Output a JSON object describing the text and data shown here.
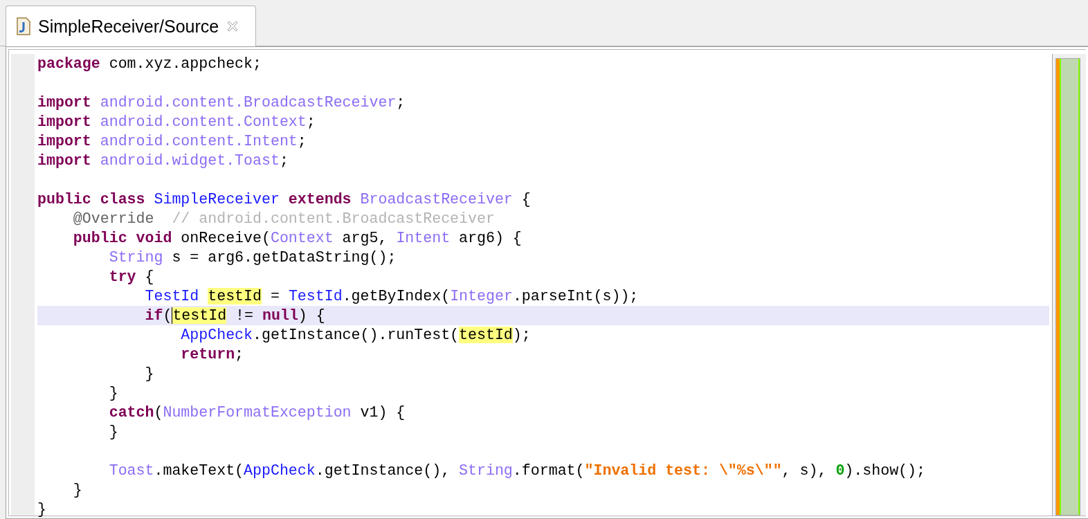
{
  "tabs": [
    {
      "label": "SimpleReceiver/Source",
      "selected": true
    }
  ],
  "code_lines": [
    {
      "kind": "code",
      "current": false,
      "tokens": [
        {
          "text": "package ",
          "kind": "kw"
        },
        {
          "text": "com.xyz.appcheck;",
          "kind": "plain"
        }
      ]
    },
    {
      "kind": "blank"
    },
    {
      "kind": "code",
      "current": false,
      "tokens": [
        {
          "text": "import ",
          "kind": "kw"
        },
        {
          "text": "android.content.BroadcastReceiver",
          "kind": "ext"
        },
        {
          "text": ";",
          "kind": "plain"
        }
      ]
    },
    {
      "kind": "code",
      "current": false,
      "tokens": [
        {
          "text": "import ",
          "kind": "kw"
        },
        {
          "text": "android.content.Context",
          "kind": "ext"
        },
        {
          "text": ";",
          "kind": "plain"
        }
      ]
    },
    {
      "kind": "code",
      "current": false,
      "tokens": [
        {
          "text": "import ",
          "kind": "kw"
        },
        {
          "text": "android.content.Intent",
          "kind": "ext"
        },
        {
          "text": ";",
          "kind": "plain"
        }
      ]
    },
    {
      "kind": "code",
      "current": false,
      "tokens": [
        {
          "text": "import ",
          "kind": "kw"
        },
        {
          "text": "android.widget.Toast",
          "kind": "ext"
        },
        {
          "text": ";",
          "kind": "plain"
        }
      ]
    },
    {
      "kind": "blank"
    },
    {
      "kind": "code",
      "current": false,
      "tokens": [
        {
          "text": "public class ",
          "kind": "kw"
        },
        {
          "text": "SimpleReceiver ",
          "kind": "cls"
        },
        {
          "text": "extends ",
          "kind": "kw"
        },
        {
          "text": "BroadcastReceiver",
          "kind": "ext"
        },
        {
          "text": " {",
          "kind": "plain"
        }
      ]
    },
    {
      "kind": "code",
      "current": false,
      "tokens": [
        {
          "text": "    @Override",
          "kind": "ann"
        },
        {
          "text": "  // android.content.BroadcastReceiver",
          "kind": "cmt"
        }
      ]
    },
    {
      "kind": "code",
      "current": false,
      "tokens": [
        {
          "text": "    public void",
          "kind": "kw"
        },
        {
          "text": " onReceive(",
          "kind": "plain"
        },
        {
          "text": "Context",
          "kind": "ext"
        },
        {
          "text": " arg5, ",
          "kind": "plain"
        },
        {
          "text": "Intent",
          "kind": "ext"
        },
        {
          "text": " arg6) {",
          "kind": "plain"
        }
      ]
    },
    {
      "kind": "code",
      "current": false,
      "tokens": [
        {
          "text": "        String",
          "kind": "ext"
        },
        {
          "text": " s = arg6.getDataString();",
          "kind": "plain"
        }
      ]
    },
    {
      "kind": "code",
      "current": false,
      "tokens": [
        {
          "text": "        try",
          "kind": "kw"
        },
        {
          "text": " {",
          "kind": "plain"
        }
      ]
    },
    {
      "kind": "code",
      "current": false,
      "tokens": [
        {
          "text": "            TestId ",
          "kind": "cls"
        },
        {
          "text": "testId",
          "kind": "plain",
          "mark": true
        },
        {
          "text": " = ",
          "kind": "plain"
        },
        {
          "text": "TestId",
          "kind": "cls"
        },
        {
          "text": ".getByIndex(",
          "kind": "plain"
        },
        {
          "text": "Integer",
          "kind": "ext"
        },
        {
          "text": ".parseInt(s));",
          "kind": "plain"
        }
      ]
    },
    {
      "kind": "code",
      "current": true,
      "tokens": [
        {
          "text": "            if",
          "kind": "kw"
        },
        {
          "text": "(",
          "kind": "plain"
        },
        {
          "text": "testId",
          "kind": "plain",
          "mark": true,
          "caret": true
        },
        {
          "text": " != ",
          "kind": "plain"
        },
        {
          "text": "null",
          "kind": "kw"
        },
        {
          "text": ") {",
          "kind": "plain"
        }
      ]
    },
    {
      "kind": "code",
      "current": false,
      "tokens": [
        {
          "text": "                AppCheck",
          "kind": "cls"
        },
        {
          "text": ".getInstance().runTest(",
          "kind": "plain"
        },
        {
          "text": "testId",
          "kind": "plain",
          "mark": true
        },
        {
          "text": ");",
          "kind": "plain"
        }
      ]
    },
    {
      "kind": "code",
      "current": false,
      "tokens": [
        {
          "text": "                return",
          "kind": "kw"
        },
        {
          "text": ";",
          "kind": "plain"
        }
      ]
    },
    {
      "kind": "code",
      "current": false,
      "tokens": [
        {
          "text": "            }",
          "kind": "plain"
        }
      ]
    },
    {
      "kind": "code",
      "current": false,
      "tokens": [
        {
          "text": "        }",
          "kind": "plain"
        }
      ]
    },
    {
      "kind": "code",
      "current": false,
      "tokens": [
        {
          "text": "        catch",
          "kind": "kw"
        },
        {
          "text": "(",
          "kind": "plain"
        },
        {
          "text": "NumberFormatException",
          "kind": "ext"
        },
        {
          "text": " v1) {",
          "kind": "plain"
        }
      ]
    },
    {
      "kind": "code",
      "current": false,
      "tokens": [
        {
          "text": "        }",
          "kind": "plain"
        }
      ]
    },
    {
      "kind": "blank"
    },
    {
      "kind": "code",
      "current": false,
      "tokens": [
        {
          "text": "        Toast",
          "kind": "ext"
        },
        {
          "text": ".makeText(",
          "kind": "plain"
        },
        {
          "text": "AppCheck",
          "kind": "cls"
        },
        {
          "text": ".getInstance(), ",
          "kind": "plain"
        },
        {
          "text": "String",
          "kind": "ext"
        },
        {
          "text": ".format(",
          "kind": "plain"
        },
        {
          "text": "\"Invalid test: \\\"%s\\\"\"",
          "kind": "str"
        },
        {
          "text": ", s), ",
          "kind": "plain"
        },
        {
          "text": "0",
          "kind": "num"
        },
        {
          "text": ").show();",
          "kind": "plain"
        }
      ]
    },
    {
      "kind": "code",
      "current": false,
      "tokens": [
        {
          "text": "    }",
          "kind": "plain"
        }
      ]
    },
    {
      "kind": "code",
      "current": false,
      "tokens": [
        {
          "text": "}",
          "kind": "plain"
        }
      ]
    }
  ]
}
